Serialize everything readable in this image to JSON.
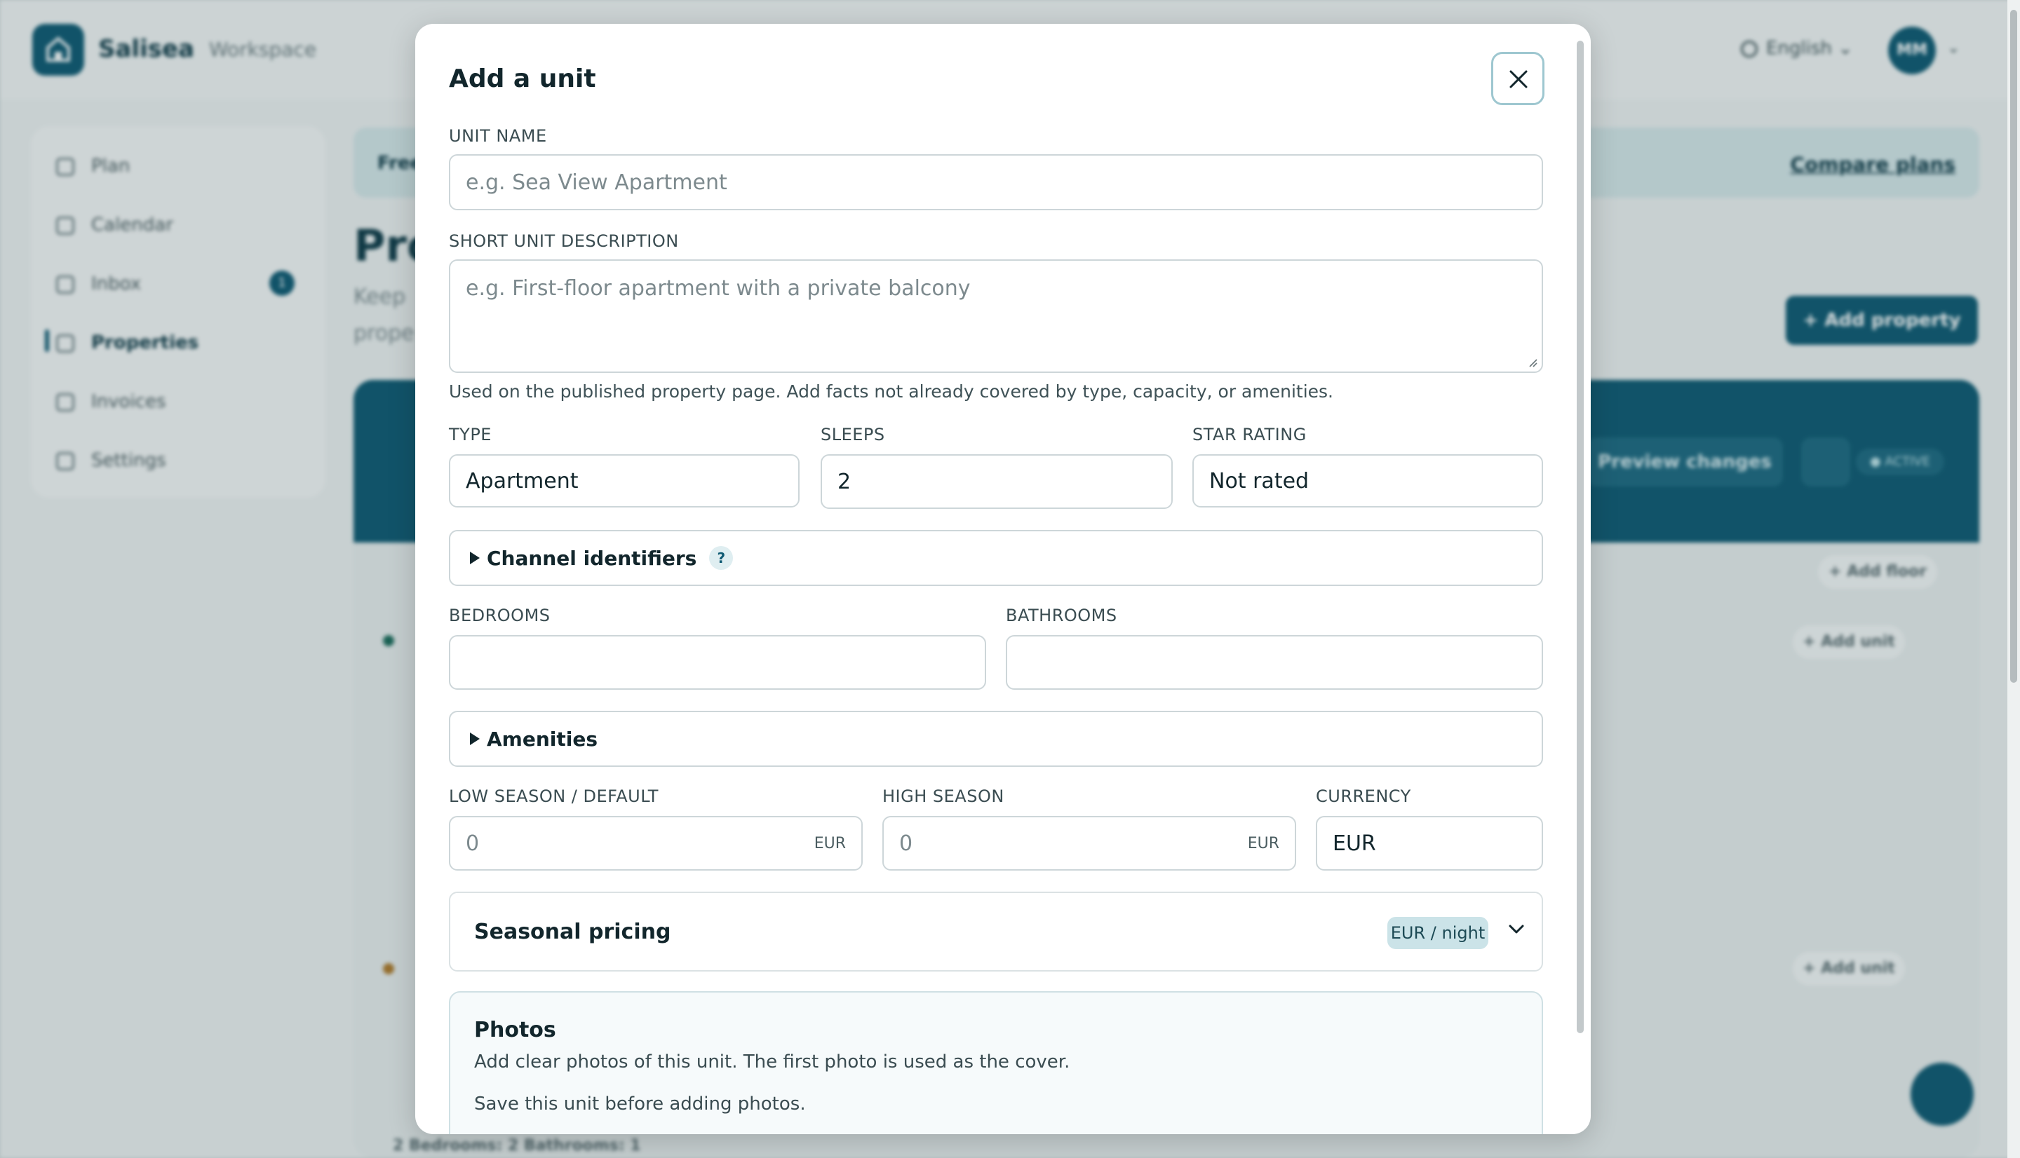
{
  "app": {
    "brand": "Salisea",
    "workspace": "Workspace",
    "language": "English",
    "user_initials": "MM"
  },
  "sidebar": {
    "items": [
      {
        "label": "Plan"
      },
      {
        "label": "Calendar"
      },
      {
        "label": "Inbox",
        "badge": "1"
      },
      {
        "label": "Properties"
      },
      {
        "label": "Invoices"
      },
      {
        "label": "Settings"
      }
    ]
  },
  "background": {
    "plan_banner": "Free",
    "compare_plans": "Compare plans",
    "page_title": "Pro",
    "page_sub": "Keep prope",
    "add_property": "+ Add property",
    "preview_changes": "Preview changes",
    "active_badge": "● ACTIVE",
    "add_floor": "+ Add floor",
    "add_unit": "+ Add unit",
    "unit_meta": "2   Bedrooms: 2   Bathrooms: 1"
  },
  "modal": {
    "title": "Add a unit",
    "unit_name": {
      "label": "UNIT NAME",
      "placeholder": "e.g. Sea View Apartment"
    },
    "short_description": {
      "label": "SHORT UNIT DESCRIPTION",
      "placeholder": "e.g. First-floor apartment with a private balcony",
      "hint": "Used on the published property page. Add facts not already covered by type, capacity, or amenities."
    },
    "type": {
      "label": "TYPE",
      "value": "Apartment"
    },
    "sleeps": {
      "label": "SLEEPS",
      "value": "2"
    },
    "star_rating": {
      "label": "STAR RATING",
      "value": "Not rated"
    },
    "channel_identifiers": {
      "label": "Channel identifiers",
      "help": "?"
    },
    "bedrooms": {
      "label": "BEDROOMS",
      "value": ""
    },
    "bathrooms": {
      "label": "BATHROOMS",
      "value": ""
    },
    "amenities": {
      "label": "Amenities"
    },
    "low_season": {
      "label": "LOW SEASON / DEFAULT",
      "value": "0",
      "suffix": "EUR"
    },
    "high_season": {
      "label": "HIGH SEASON",
      "value": "0",
      "suffix": "EUR"
    },
    "currency": {
      "label": "CURRENCY",
      "value": "EUR"
    },
    "seasonal_pricing": {
      "label": "Seasonal pricing",
      "badge": "EUR / night"
    },
    "photos": {
      "title": "Photos",
      "description": "Add clear photos of this unit. The first photo is used as the cover.",
      "note": "Save this unit before adding photos."
    }
  }
}
